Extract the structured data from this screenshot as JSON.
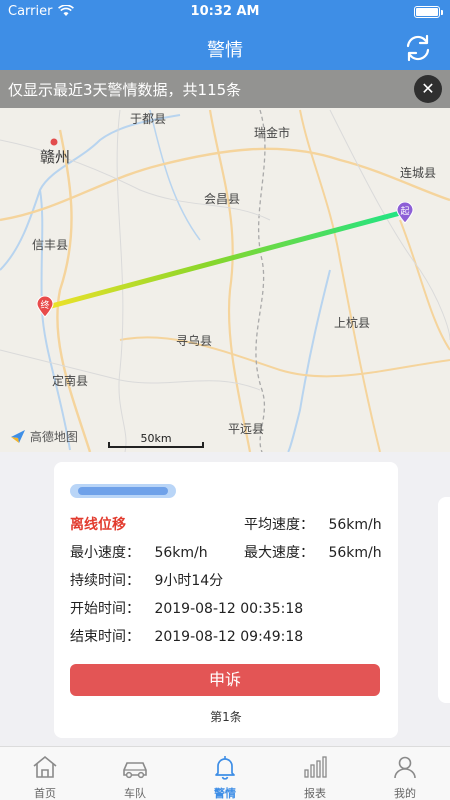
{
  "status_bar": {
    "carrier": "Carrier",
    "time": "10:32 AM"
  },
  "nav": {
    "title": "警情",
    "refresh_icon": "refresh-icon"
  },
  "notice": {
    "text": "仅显示最近3天警情数据，共115条",
    "close_icon": "close-icon"
  },
  "map": {
    "labels": {
      "yudu": "于都县",
      "ruijin": "瑞金市",
      "ganzhou": "赣州",
      "liancheng": "连城县",
      "huichang": "会昌县",
      "xinfeng": "信丰县",
      "shanghang": "上杭县",
      "xunwu": "寻乌县",
      "dingnan": "定南县",
      "pingyuan": "平远县"
    },
    "logo_text": "高德地图",
    "scale_text": "50km",
    "start_marker": "终",
    "end_marker": "起"
  },
  "record": {
    "type": "离线位移",
    "avg_speed_label": "平均速度：",
    "avg_speed": "56km/h",
    "min_speed_label": "最小速度：",
    "min_speed": "56km/h",
    "max_speed_label": "最大速度：",
    "max_speed": "56km/h",
    "duration_label": "持续时间：",
    "duration": "9小时14分",
    "start_label": "开始时间：",
    "start_time": "2019-08-12 00:35:18",
    "end_label": "结束时间：",
    "end_time": "2019-08-12 09:49:18",
    "appeal_label": "申诉",
    "page_indicator": "第1条"
  },
  "tabs": [
    {
      "label": "首页",
      "icon": "home-icon"
    },
    {
      "label": "车队",
      "icon": "car-icon"
    },
    {
      "label": "警情",
      "icon": "bell-icon",
      "active": true
    },
    {
      "label": "报表",
      "icon": "chart-icon"
    },
    {
      "label": "我的",
      "icon": "user-icon"
    }
  ],
  "colors": {
    "primary": "#3e8ee6",
    "alert": "#e23c2f",
    "appeal": "#e35555"
  }
}
